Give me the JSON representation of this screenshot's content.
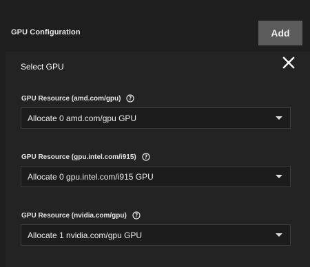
{
  "section": {
    "title": "GPU Configuration",
    "add_label": "Add"
  },
  "panel": {
    "title": "Select GPU",
    "close_icon": "close-icon"
  },
  "fields": [
    {
      "label": "GPU Resource (amd.com/gpu)",
      "value": "Allocate 0 amd.com/gpu GPU",
      "help_icon": "help-circle-icon"
    },
    {
      "label": "GPU Resource (gpu.intel.com/i915)",
      "value": "Allocate 0 gpu.intel.com/i915 GPU",
      "help_icon": "help-circle-icon"
    },
    {
      "label": "GPU Resource (nvidia.com/gpu)",
      "value": "Allocate 1 nvidia.com/gpu GPU",
      "help_icon": "help-circle-icon"
    }
  ]
}
